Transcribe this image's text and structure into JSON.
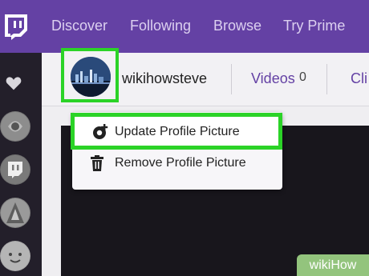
{
  "nav": {
    "items": [
      "Discover",
      "Following",
      "Browse",
      "Try Prime"
    ]
  },
  "profile": {
    "username": "wikihowsteve",
    "videos_label": "Videos",
    "videos_count": "0",
    "clips_label": "Cli"
  },
  "menu": {
    "update_label": "Update Profile Picture",
    "remove_label": "Remove Profile Picture"
  },
  "watermark": {
    "text": "wikiHow"
  },
  "colors": {
    "brand_purple": "#6441a4",
    "highlight_green": "#2bd327",
    "watermark_green": "#93c47d"
  },
  "icons": [
    "twitch-logo-icon",
    "heart-icon",
    "add-photo-icon",
    "trash-icon"
  ]
}
